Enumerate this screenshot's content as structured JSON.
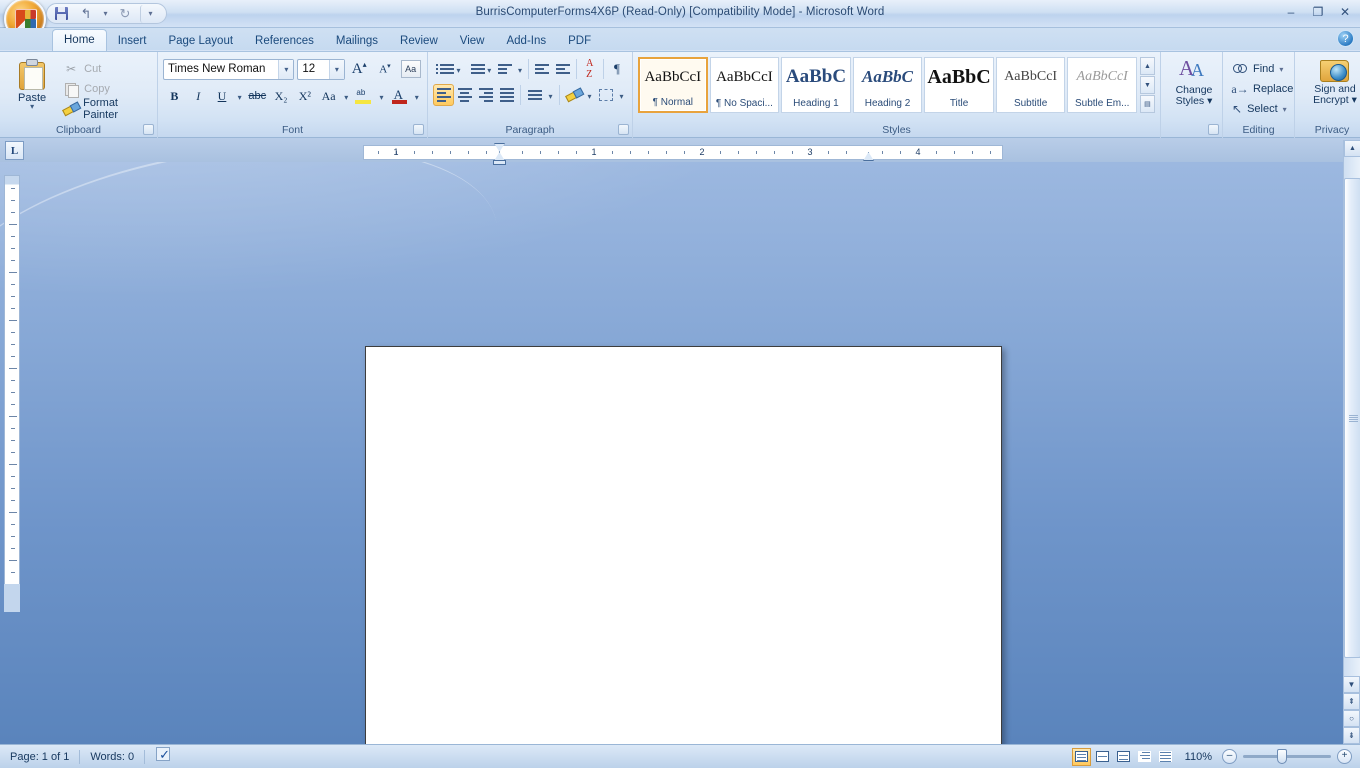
{
  "window": {
    "title": "BurrisComputerForms4X6P (Read-Only) [Compatibility Mode] - Microsoft Word",
    "minimize": "–",
    "restore": "❐",
    "close": "✕",
    "help": "?"
  },
  "quick_access": {
    "save": "Save",
    "undo": "Undo",
    "undo_glyph": "↰",
    "redo_glyph": "↻",
    "customize_glyph": "▾"
  },
  "tabs": [
    {
      "label": "Home",
      "active": true
    },
    {
      "label": "Insert",
      "active": false
    },
    {
      "label": "Page Layout",
      "active": false
    },
    {
      "label": "References",
      "active": false
    },
    {
      "label": "Mailings",
      "active": false
    },
    {
      "label": "Review",
      "active": false
    },
    {
      "label": "View",
      "active": false
    },
    {
      "label": "Add-Ins",
      "active": false
    },
    {
      "label": "PDF",
      "active": false
    }
  ],
  "clipboard": {
    "group_label": "Clipboard",
    "paste": "Paste",
    "paste_caret": "▾",
    "cut": "Cut",
    "copy": "Copy",
    "format_painter": "Format Painter",
    "launcher": "◪"
  },
  "font": {
    "group_label": "Font",
    "font_name": "Times New Roman",
    "font_size": "12",
    "caret": "▾",
    "grow_font": "A",
    "shrink_font": "A",
    "clear_formatting": "Aa",
    "bold": "B",
    "italic": "I",
    "underline": "U",
    "strikethrough": "abc",
    "subscript": "X₂",
    "superscript": "X²",
    "change_case": "Aa",
    "highlight": "ab",
    "font_color": "A",
    "launcher": "◪"
  },
  "paragraph": {
    "group_label": "Paragraph",
    "bullets": "Bullets",
    "numbering": "Numbering",
    "multilevel": "Multilevel List",
    "decrease_indent": "Decrease Indent",
    "increase_indent": "Increase Indent",
    "sort": "Sort",
    "sort_a": "A",
    "sort_z": "Z",
    "sort_arrow": "↓",
    "show_marks": "¶",
    "align_left": "Align Left",
    "center": "Center",
    "align_right": "Align Right",
    "justify": "Justify",
    "line_spacing": "Line Spacing",
    "shading": "Shading",
    "borders": "Borders",
    "caret": "▾",
    "launcher": "◪"
  },
  "styles": {
    "group_label": "Styles",
    "items": [
      {
        "preview": "AaBbCcI",
        "name": "¶ Normal",
        "selected": true
      },
      {
        "preview": "AaBbCcI",
        "name": "¶ No Spaci...",
        "selected": false
      },
      {
        "preview": "AaBbC",
        "name": "Heading 1",
        "selected": false
      },
      {
        "preview": "AaBbC",
        "name": "Heading 2",
        "selected": false
      },
      {
        "preview": "AaBbC",
        "name": "Title",
        "selected": false
      },
      {
        "preview": "AaBbCcI",
        "name": "Subtitle",
        "selected": false
      },
      {
        "preview": "AaBbCcI",
        "name": "Subtle Em...",
        "selected": false
      }
    ],
    "scroll_up": "▲",
    "scroll_down": "▼",
    "more": "▤",
    "launcher": "◪"
  },
  "change_styles": {
    "label_line1": "Change",
    "label_line2": "Styles",
    "caret": "▾"
  },
  "editing": {
    "group_label": "Editing",
    "find": "Find",
    "replace": "Replace",
    "select": "Select",
    "caret": "▾"
  },
  "privacy": {
    "group_label": "Privacy",
    "label_line1": "Sign and",
    "label_line2": "Encrypt",
    "caret": "▾"
  },
  "ruler": {
    "tab_selector": "L",
    "numbers": [
      "1",
      "1",
      "2",
      "3",
      "4"
    ]
  },
  "status": {
    "page": "Page: 1 of 1",
    "words": "Words: 0",
    "proofing": "Proofing errors",
    "zoom": "110%",
    "zoom_out": "–",
    "zoom_in": "+",
    "views": [
      {
        "name": "Print Layout",
        "active": true
      },
      {
        "name": "Full Screen Reading",
        "active": false
      },
      {
        "name": "Web Layout",
        "active": false
      },
      {
        "name": "Outline",
        "active": false
      },
      {
        "name": "Draft",
        "active": false
      }
    ]
  },
  "scrollbar": {
    "up": "▲",
    "down": "▼",
    "prev_page": "⇞",
    "browse": "○",
    "next_page": "⇟"
  },
  "colors": {
    "accent": "#e8a33d",
    "chrome": "#cfe0f3",
    "desk_top": "#9cb8e0",
    "desk_bottom": "#5a84bc"
  }
}
